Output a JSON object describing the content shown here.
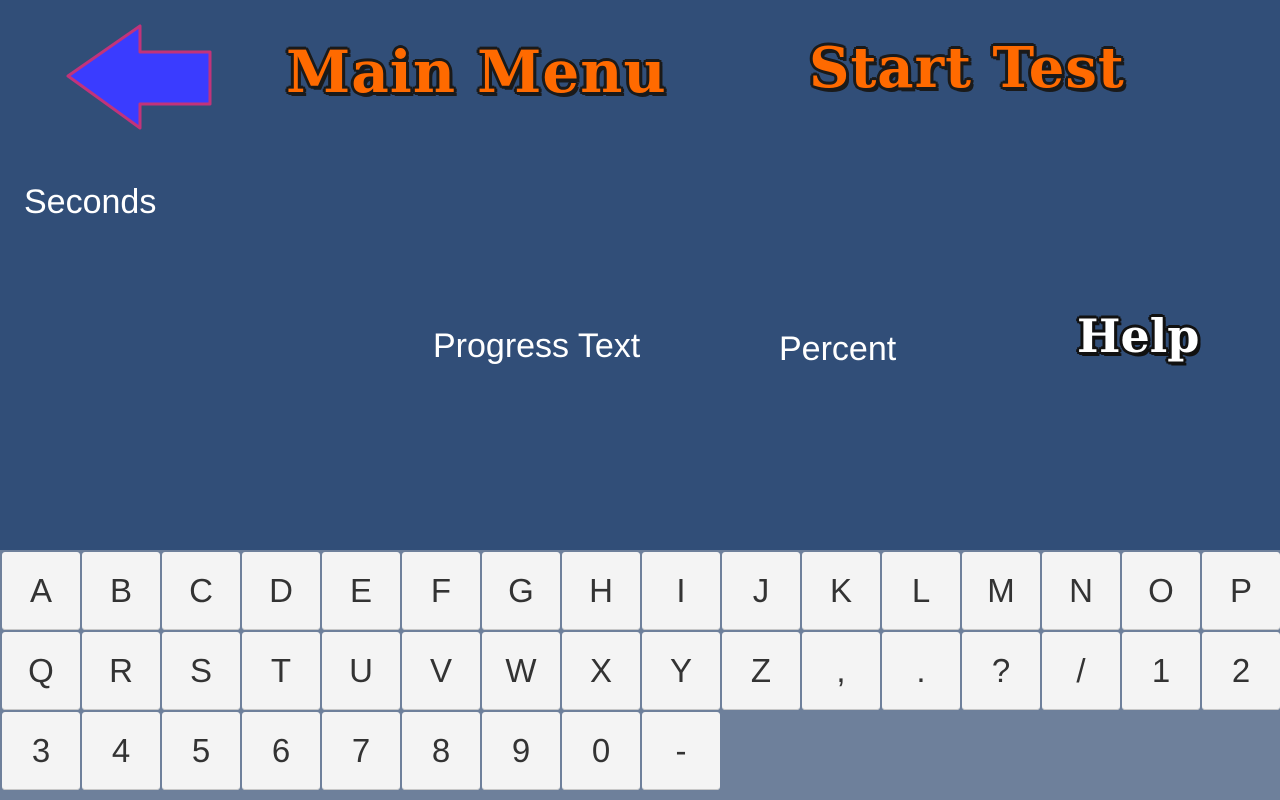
{
  "header": {
    "back_icon": "left-arrow-icon",
    "main_menu_label": "Main Menu",
    "start_test_label": "Start Test"
  },
  "status": {
    "seconds_label": "Seconds",
    "progress_label": "Progress Text",
    "percent_label": "Percent"
  },
  "help_label": "Help",
  "keyboard": {
    "keys": [
      "A",
      "B",
      "C",
      "D",
      "E",
      "F",
      "G",
      "H",
      "I",
      "J",
      "K",
      "L",
      "M",
      "N",
      "O",
      "P",
      "Q",
      "R",
      "S",
      "T",
      "U",
      "V",
      "W",
      "X",
      "Y",
      "Z",
      ",",
      ".",
      "?",
      "/",
      "1",
      "2",
      "3",
      "4",
      "5",
      "6",
      "7",
      "8",
      "9",
      "0",
      "-"
    ]
  },
  "colors": {
    "background": "#314e78",
    "title_orange": "#ff6a00",
    "arrow_fill": "#3a3cff",
    "arrow_outline": "#c2337a",
    "key_fill": "#f4f4f4",
    "keyboard_panel": "#6e809b"
  }
}
